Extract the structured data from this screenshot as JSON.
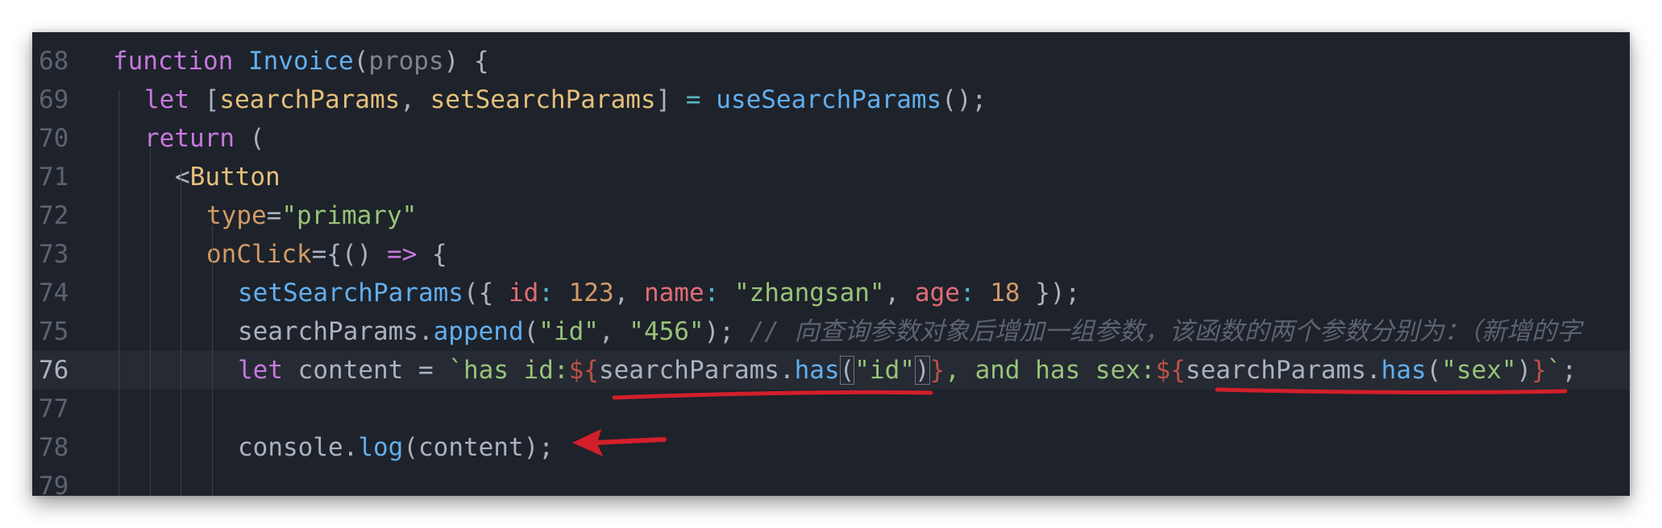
{
  "editor": {
    "colors": {
      "background": "#1e222a",
      "active_line": "#252a33",
      "keyword": "#c678dd",
      "function": "#61afef",
      "string": "#98c379",
      "number": "#d19a66",
      "property": "#e06c75",
      "annotation": "#d21f2b"
    },
    "lines": [
      {
        "number": "68",
        "tokens": [
          {
            "t": "function",
            "c": "kw"
          },
          {
            "t": " ",
            "c": "punc"
          },
          {
            "t": "Invoice",
            "c": "fn"
          },
          {
            "t": "(",
            "c": "punc"
          },
          {
            "t": "props",
            "c": "param"
          },
          {
            "t": ") {",
            "c": "punc"
          }
        ]
      },
      {
        "number": "69",
        "tokens": [
          {
            "t": "let",
            "c": "kw"
          },
          {
            "t": " [",
            "c": "punc"
          },
          {
            "t": "searchParams",
            "c": "var"
          },
          {
            "t": ", ",
            "c": "punc"
          },
          {
            "t": "setSearchParams",
            "c": "var"
          },
          {
            "t": "] ",
            "c": "punc"
          },
          {
            "t": "=",
            "c": "op"
          },
          {
            "t": " ",
            "c": "punc"
          },
          {
            "t": "useSearchParams",
            "c": "fn"
          },
          {
            "t": "();",
            "c": "punc"
          }
        ]
      },
      {
        "number": "70",
        "tokens": [
          {
            "t": "return",
            "c": "kw"
          },
          {
            "t": " (",
            "c": "punc"
          }
        ]
      },
      {
        "number": "71",
        "tokens": [
          {
            "t": "<",
            "c": "punc"
          },
          {
            "t": "Button",
            "c": "var"
          }
        ]
      },
      {
        "number": "72",
        "tokens": [
          {
            "t": "type",
            "c": "num"
          },
          {
            "t": "=",
            "c": "punc"
          },
          {
            "t": "\"primary\"",
            "c": "str"
          }
        ]
      },
      {
        "number": "73",
        "tokens": [
          {
            "t": "onClick",
            "c": "num"
          },
          {
            "t": "={() ",
            "c": "punc"
          },
          {
            "t": "=>",
            "c": "kw"
          },
          {
            "t": " {",
            "c": "punc"
          }
        ]
      },
      {
        "number": "74",
        "tokens": [
          {
            "t": "setSearchParams",
            "c": "fn"
          },
          {
            "t": "({ ",
            "c": "punc"
          },
          {
            "t": "id",
            "c": "prop"
          },
          {
            "t": ": ",
            "c": "op"
          },
          {
            "t": "123",
            "c": "num"
          },
          {
            "t": ", ",
            "c": "punc"
          },
          {
            "t": "name",
            "c": "prop"
          },
          {
            "t": ": ",
            "c": "op"
          },
          {
            "t": "\"zhangsan\"",
            "c": "str"
          },
          {
            "t": ", ",
            "c": "punc"
          },
          {
            "t": "age",
            "c": "prop"
          },
          {
            "t": ": ",
            "c": "op"
          },
          {
            "t": "18",
            "c": "num"
          },
          {
            "t": " });",
            "c": "punc"
          }
        ]
      },
      {
        "number": "75",
        "tokens": [
          {
            "t": "searchParams",
            "c": "punc"
          },
          {
            "t": ".",
            "c": "punc"
          },
          {
            "t": "append",
            "c": "fn"
          },
          {
            "t": "(",
            "c": "punc"
          },
          {
            "t": "\"id\"",
            "c": "str"
          },
          {
            "t": ", ",
            "c": "punc"
          },
          {
            "t": "\"456\"",
            "c": "str"
          },
          {
            "t": "); ",
            "c": "punc"
          },
          {
            "t": "// 向查询参数对象后增加一组参数，该函数的两个参数分别为：（新增的字",
            "c": "com"
          }
        ]
      },
      {
        "number": "76",
        "active": true,
        "tokens": [
          {
            "t": "let",
            "c": "kw"
          },
          {
            "t": " content ",
            "c": "punc"
          },
          {
            "t": "=",
            "c": "punc"
          },
          {
            "t": " ",
            "c": "punc"
          },
          {
            "t": "`has id:",
            "c": "str"
          },
          {
            "t": "${",
            "c": "tpl"
          },
          {
            "t": "searchParams",
            "c": "punc"
          },
          {
            "t": ".",
            "c": "punc"
          },
          {
            "t": "has",
            "c": "fn"
          },
          {
            "t": "(",
            "c": "punc",
            "boxed": true
          },
          {
            "t": "\"id\"",
            "c": "str"
          },
          {
            "t": ")",
            "c": "punc",
            "boxed": true
          },
          {
            "t": "}",
            "c": "tpl"
          },
          {
            "t": ", and has sex:",
            "c": "str"
          },
          {
            "t": "${",
            "c": "tpl"
          },
          {
            "t": "searchParams",
            "c": "punc"
          },
          {
            "t": ".",
            "c": "punc"
          },
          {
            "t": "has",
            "c": "fn"
          },
          {
            "t": "(",
            "c": "punc"
          },
          {
            "t": "\"sex\"",
            "c": "str"
          },
          {
            "t": ")",
            "c": "punc"
          },
          {
            "t": "}",
            "c": "tpl"
          },
          {
            "t": "`",
            "c": "str"
          },
          {
            "t": ";",
            "c": "punc"
          }
        ]
      },
      {
        "number": "77",
        "tokens": []
      },
      {
        "number": "78",
        "tokens": [
          {
            "t": "console",
            "c": "punc"
          },
          {
            "t": ".",
            "c": "punc"
          },
          {
            "t": "log",
            "c": "fn"
          },
          {
            "t": "(content);",
            "c": "punc"
          }
        ]
      },
      {
        "number": "79",
        "tokens": []
      }
    ]
  }
}
